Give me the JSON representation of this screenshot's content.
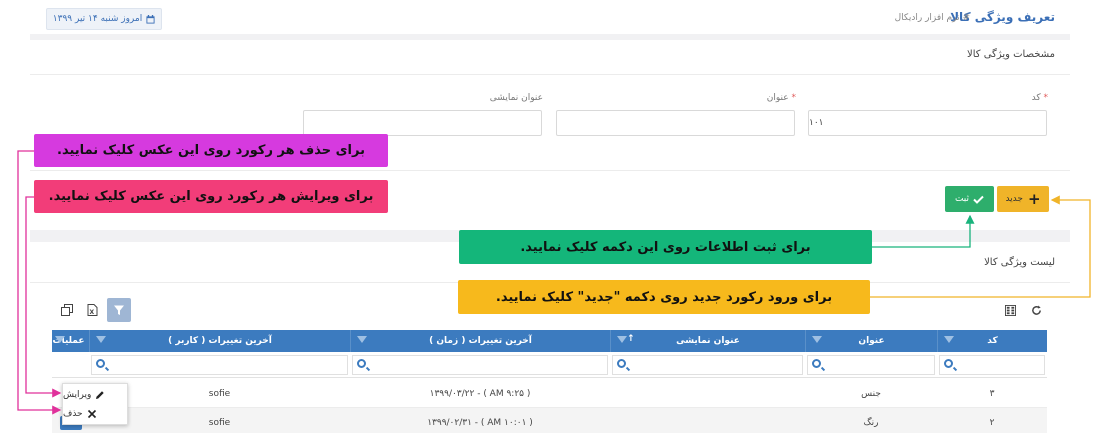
{
  "header": {
    "page_title": "تعریف ویژگی کالا",
    "breadcrumb": "# نرم افزار رادیکال",
    "date": "امروز شنبه ۱۴ تیر ۱۳۹۹"
  },
  "details": {
    "section_title": "مشخصات ویژگی کالا",
    "fields": {
      "code": {
        "label": "کد",
        "required": "*",
        "value": "۱۰۱"
      },
      "title": {
        "label": "عنوان",
        "required": "*",
        "value": ""
      },
      "display_title": {
        "label": "عنوان نمایشی",
        "value": ""
      }
    }
  },
  "toolbar": {
    "new_label": "جدید",
    "save_label": "ثبت"
  },
  "callouts": {
    "delete": "برای حذف هر رکورد روی این عکس کلیک نمایید.",
    "edit": "برای ویرایش هر رکورد روی این عکس کلیک نمایید.",
    "save": "برای ثبت اطلاعات روی این دکمه کلیک نمایید.",
    "new_record": "برای ورود رکورد جدید روی دکمه \"جدید\" کلیک نمایید."
  },
  "list": {
    "section_title": "لیست ویژگی کالا",
    "columns": {
      "code": "کد",
      "title": "عنوان",
      "display_title": "عنوان نمایشی",
      "changed_time": "آخرین تغییرات ( زمان )",
      "changed_user": "آخرین تغییرات ( کاربر )",
      "ops": "عملیات"
    },
    "rows": [
      {
        "code": "۳",
        "title": "جنس",
        "display_title": "",
        "changed_time": "۱۳۹۹/۰۳/۲۲ - ( AM ۹:۲۵ )",
        "changed_user": "sofie"
      },
      {
        "code": "۲",
        "title": "رنگ",
        "display_title": "",
        "changed_time": "۱۳۹۹/۰۲/۳۱ - ( AM ۱۰:۰۱ )",
        "changed_user": "sofie"
      }
    ]
  },
  "context_menu": {
    "edit": "ویرایش",
    "delete": "حذف"
  },
  "colors": {
    "grid_header": "#3c7bbf",
    "new_button": "#f0b429",
    "save_button": "#2eae6c",
    "callout_delete": "#d63adf",
    "callout_edit": "#f23d79",
    "callout_save": "#14b67a",
    "callout_new": "#f7b91c",
    "arrow_pink": "#e0319b",
    "arrow_green": "#19b37c",
    "arrow_orange": "#f0b429"
  }
}
